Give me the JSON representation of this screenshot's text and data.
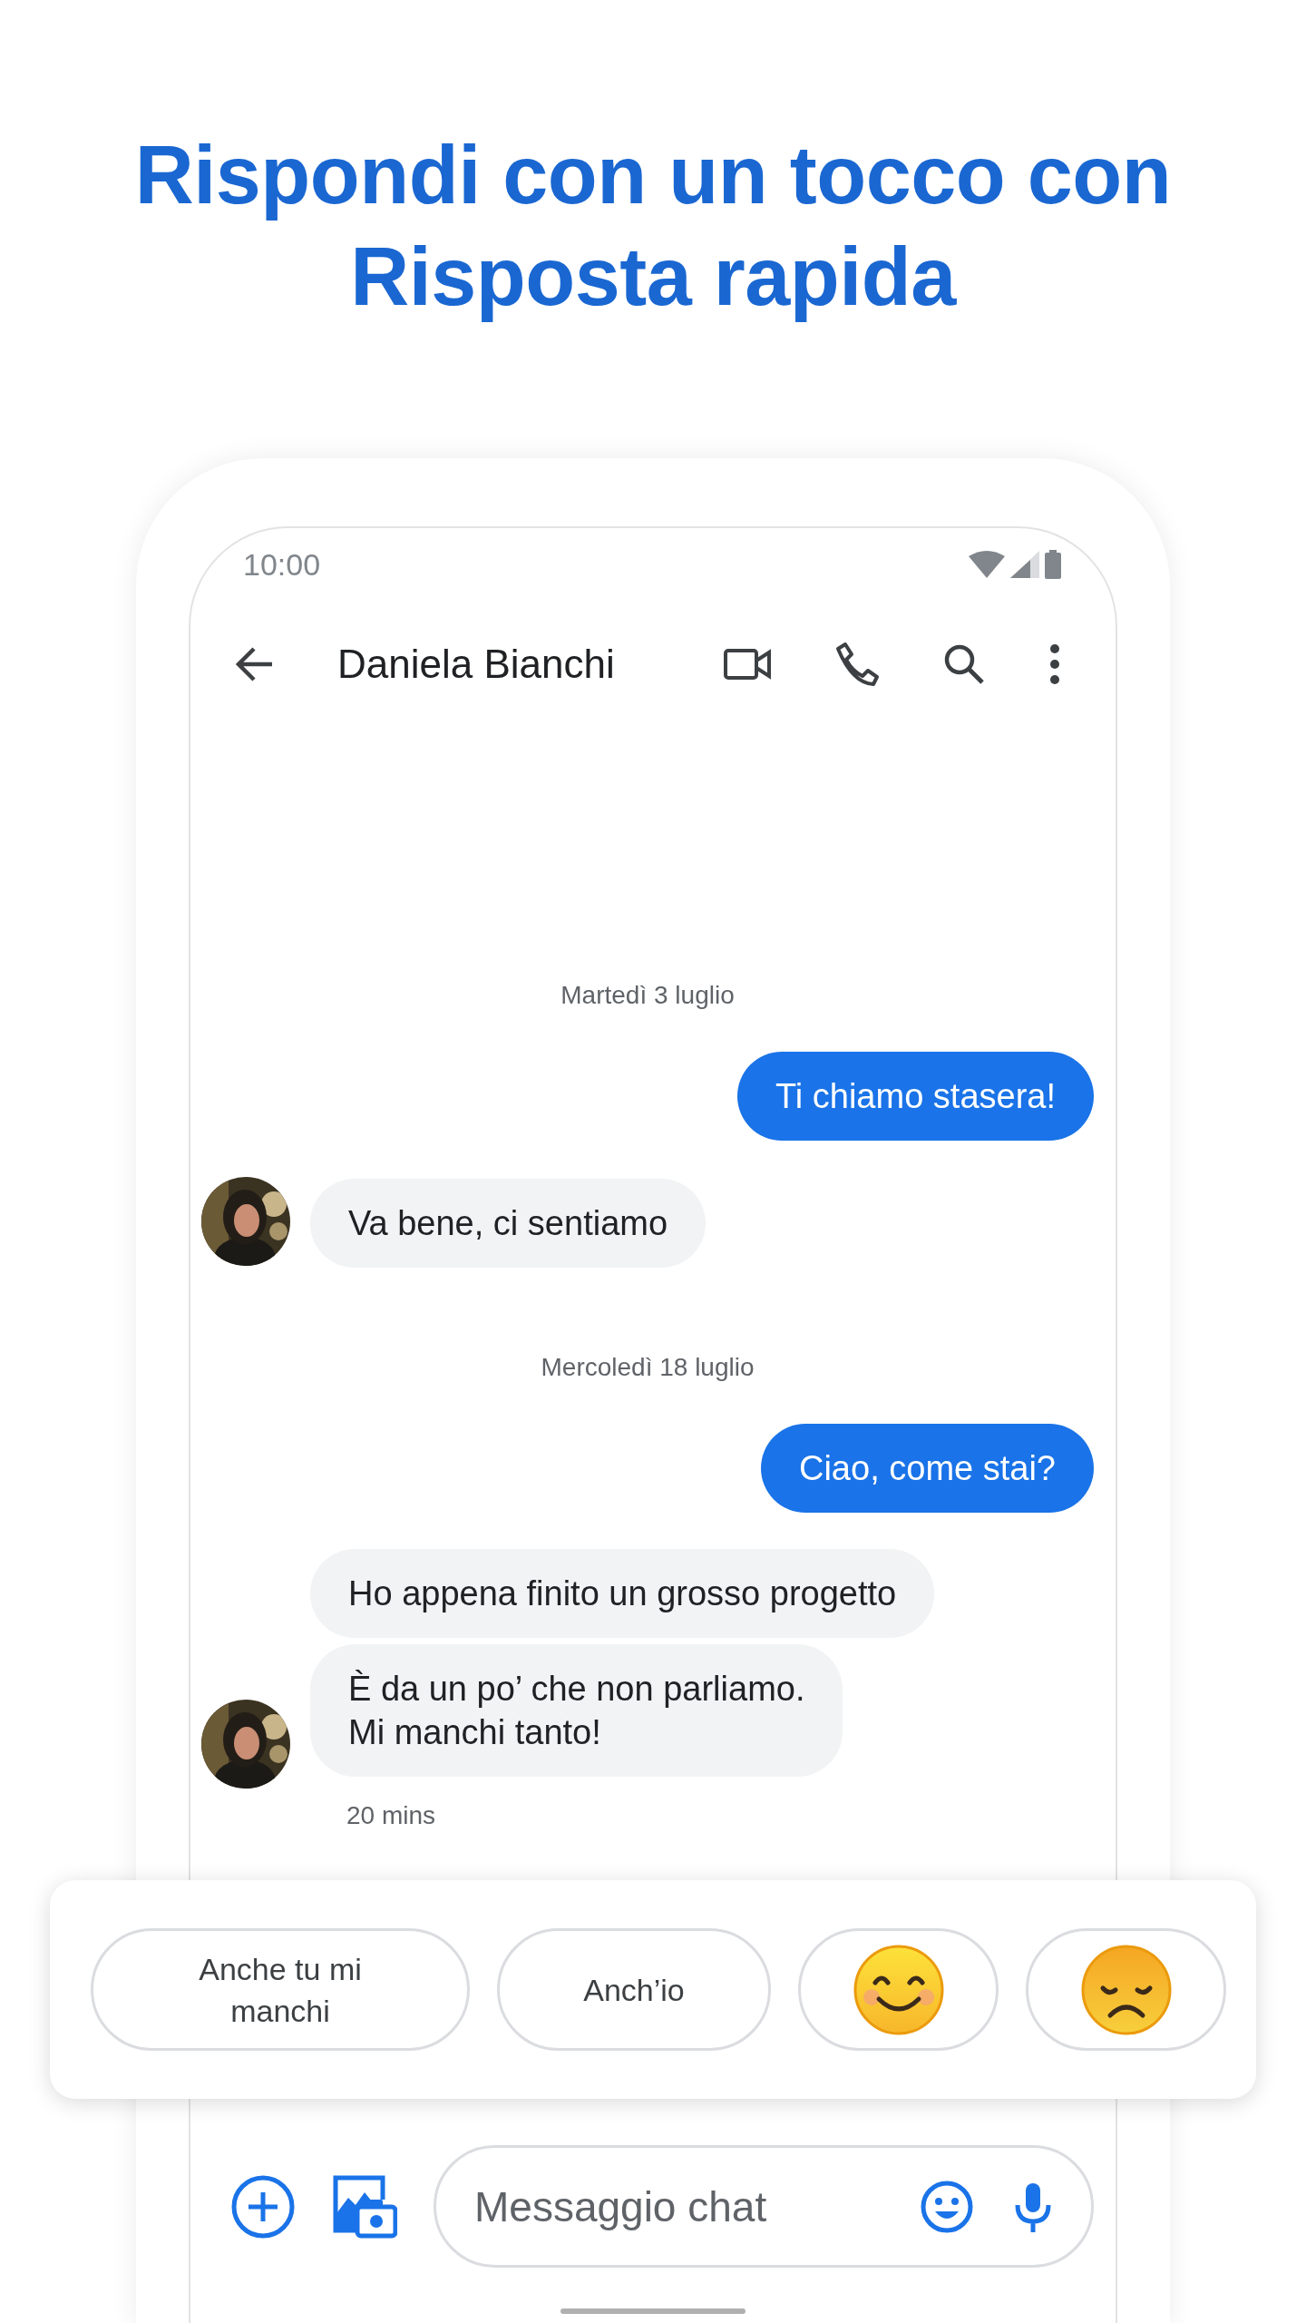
{
  "headline": [
    "Rispondi con un tocco con",
    "Risposta rapida"
  ],
  "status_bar": {
    "time": "10:00"
  },
  "toolbar": {
    "contact": "Daniela Bianchi"
  },
  "conversation": [
    {
      "kind": "date",
      "text": "Martedì 3 luglio"
    },
    {
      "kind": "outgoing",
      "lines": [
        "Ti chiamo stasera!"
      ]
    },
    {
      "kind": "incoming",
      "bubbles": [
        [
          "Va bene, ci sentiamo"
        ]
      ]
    },
    {
      "kind": "date",
      "text": "Mercoledì 18 luglio"
    },
    {
      "kind": "outgoing",
      "lines": [
        "Ciao, come stai?"
      ]
    },
    {
      "kind": "incoming",
      "bubbles": [
        [
          "Ho appena finito un grosso progetto"
        ],
        [
          "È da un po’ che non parliamo.",
          "Mi manchi tanto!"
        ]
      ],
      "time": "20 mins"
    }
  ],
  "smart_replies": [
    {
      "kind": "text",
      "label": "Anche tu mi manchi"
    },
    {
      "kind": "text",
      "label": "Anch’io"
    },
    {
      "kind": "happy"
    },
    {
      "kind": "sad"
    }
  ],
  "composer": {
    "placeholder": "Messaggio chat"
  }
}
